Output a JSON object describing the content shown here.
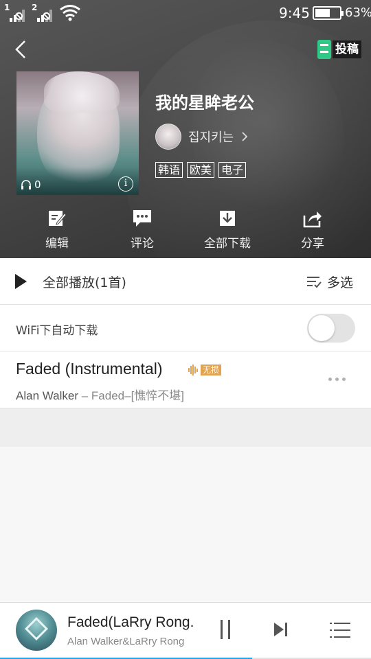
{
  "status_bar": {
    "sim1": "1",
    "sim2": "2",
    "time": "9:45",
    "battery_percent": "63%",
    "battery_level": 0.63
  },
  "header": {
    "contribute_label": "投稿",
    "play_count": "0",
    "info_label": "i",
    "playlist_title": "我的星眸老公",
    "creator_name": "집지키는",
    "tags": [
      "韩语",
      "欧美",
      "电子"
    ]
  },
  "actions": [
    {
      "label": "编辑",
      "icon": "edit-icon"
    },
    {
      "label": "评论",
      "icon": "comment-icon"
    },
    {
      "label": "全部下载",
      "icon": "download-icon"
    },
    {
      "label": "分享",
      "icon": "share-icon"
    }
  ],
  "list": {
    "play_all_label": "全部播放(1首)",
    "multi_select_label": "多选",
    "wifi_auto_download_label": "WiFi下自动下载",
    "wifi_auto_download_enabled": false,
    "songs": [
      {
        "title": "Faded (Instrumental)",
        "quality_badge": "无损",
        "artist": "Alan Walker",
        "album_suffix": " – Faded–[憔悴不堪]"
      }
    ]
  },
  "mini_player": {
    "title": "Faded(LaRry Rong.",
    "artist": "Alan Walker&LaRry Rong",
    "progress": 0.68,
    "accent_color": "#27a2e8"
  }
}
